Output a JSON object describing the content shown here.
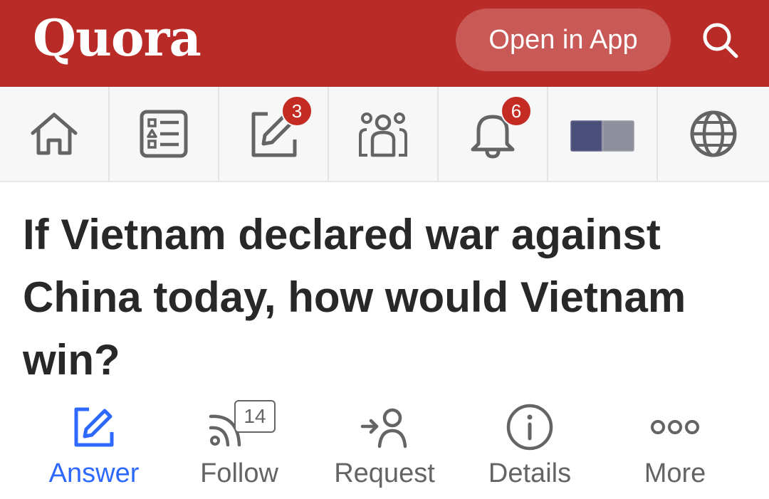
{
  "header": {
    "logo": "Quora",
    "open_in_app_label": "Open in App",
    "search_icon": "search-icon",
    "background_color": "#b92b27"
  },
  "nav": {
    "items": [
      {
        "name": "home",
        "icon": "home-icon"
      },
      {
        "name": "following",
        "icon": "list-icon"
      },
      {
        "name": "answer",
        "icon": "edit-icon",
        "badge": "3"
      },
      {
        "name": "spaces",
        "icon": "people-icon"
      },
      {
        "name": "notifications",
        "icon": "bell-icon",
        "badge": "6"
      },
      {
        "name": "profile",
        "icon": "avatar"
      },
      {
        "name": "language",
        "icon": "globe-icon"
      }
    ]
  },
  "question": {
    "title": "If Vietnam declared war against China today, how would Vietnam win?"
  },
  "actions": {
    "answer": {
      "label": "Answer",
      "icon": "pencil-square-icon",
      "color": "#2e69ff"
    },
    "follow": {
      "label": "Follow",
      "icon": "rss-icon",
      "count": "14"
    },
    "request": {
      "label": "Request",
      "icon": "user-arrow-icon"
    },
    "details": {
      "label": "Details",
      "icon": "info-icon"
    },
    "more": {
      "label": "More",
      "icon": "ellipsis-icon"
    }
  }
}
